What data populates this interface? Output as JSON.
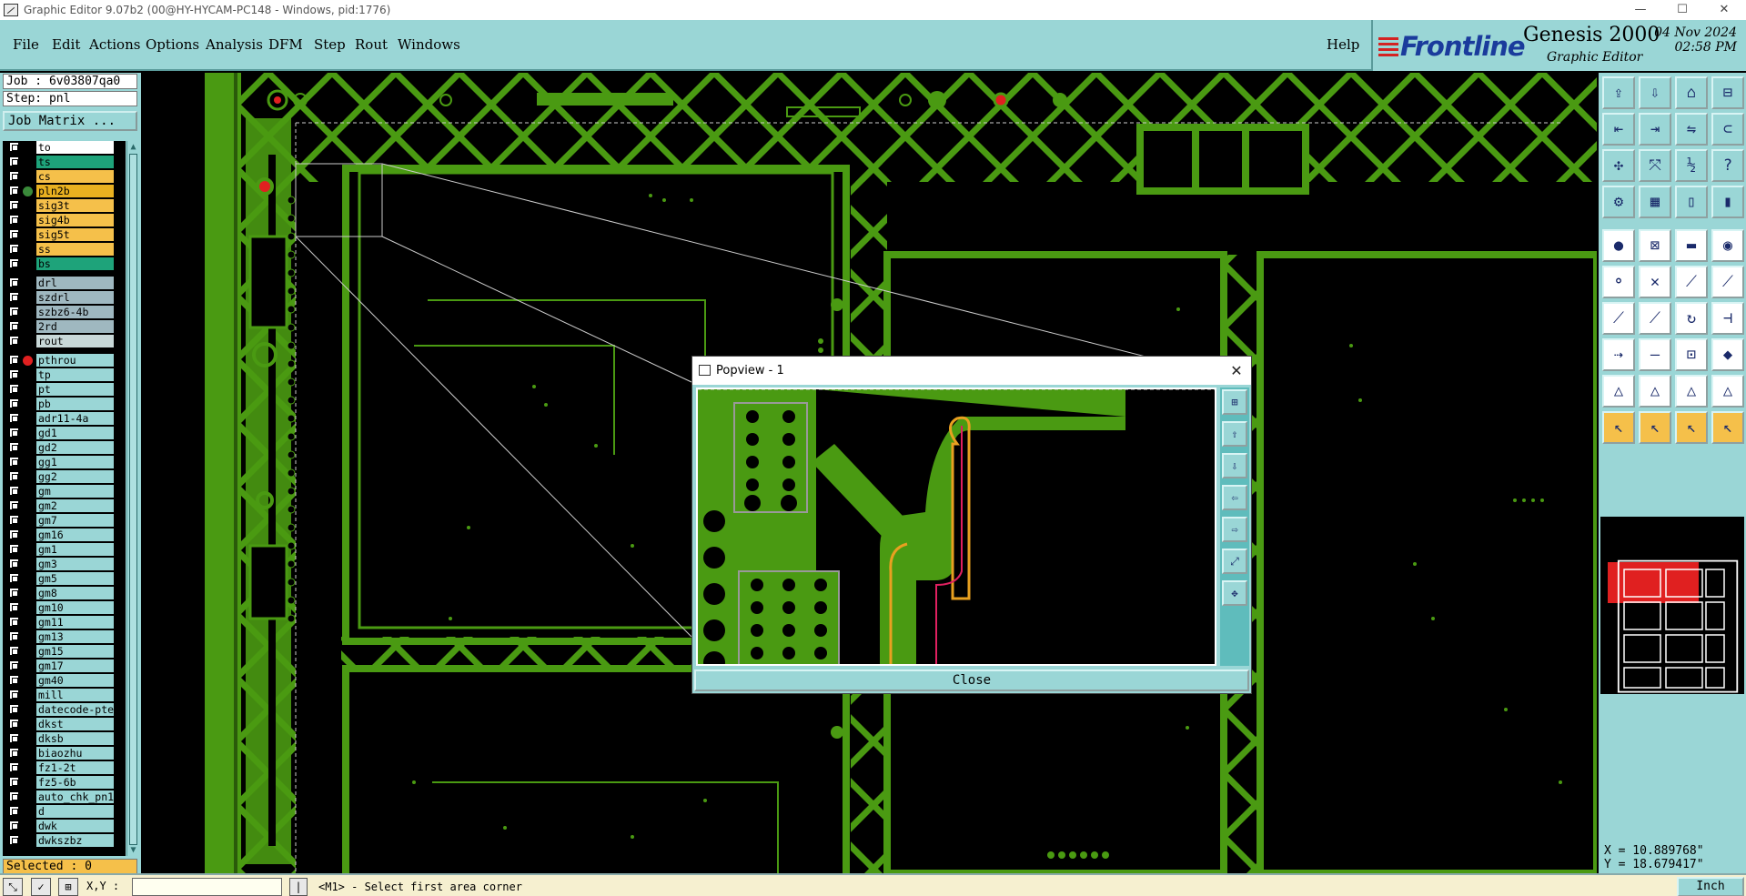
{
  "window": {
    "title": "Graphic Editor 9.07b2 (00@HY-HYCAM-PC148 - Windows, pid:1776)",
    "minimize": "—",
    "maximize": "☐",
    "close": "✕"
  },
  "menu": {
    "items": [
      "File",
      "Edit",
      "Actions",
      "Options",
      "Analysis",
      "DFM",
      "Step",
      "Rout",
      "Windows"
    ],
    "help": "Help"
  },
  "logo": {
    "brand": "Frontline",
    "product": "Genesis 2000",
    "subtitle": "Graphic Editor",
    "date": "04 Nov 2024",
    "time": "02:58 PM"
  },
  "left_panel": {
    "job": "Job : 6v03807qa0",
    "step": "Step: pnl",
    "job_matrix_button": "Job Matrix ...",
    "selected": "Selected : 0"
  },
  "colors": {
    "panel": "#9ad6d6",
    "copper": "#4a9a12",
    "signal_yellow": "#f5c04a",
    "plane_green": "#1ea37a",
    "drill_gray": "#9fb8c0",
    "doc_cyan": "#9ad6d6",
    "active_red": "#e02020"
  },
  "layers": [
    {
      "name": "to",
      "color": "#ffffff",
      "dot": ""
    },
    {
      "name": "ts",
      "color": "#1ea37a",
      "dot": ""
    },
    {
      "name": "cs",
      "color": "#f5c04a",
      "dot": ""
    },
    {
      "name": "pln2b",
      "color": "#e8b020",
      "dot": "#3a8a3a"
    },
    {
      "name": "sig3t",
      "color": "#f5c04a",
      "dot": ""
    },
    {
      "name": "sig4b",
      "color": "#f5c04a",
      "dot": ""
    },
    {
      "name": "sig5t",
      "color": "#f5c04a",
      "dot": ""
    },
    {
      "name": "ss",
      "color": "#f5c04a",
      "dot": ""
    },
    {
      "name": "bs",
      "color": "#1ea37a",
      "dot": ""
    },
    {
      "name": "drl",
      "color": "#9fb8c0",
      "dot": ""
    },
    {
      "name": "szdrl",
      "color": "#9fb8c0",
      "dot": ""
    },
    {
      "name": "szbz6-4b",
      "color": "#9fb8c0",
      "dot": ""
    },
    {
      "name": "2rd",
      "color": "#9fb8c0",
      "dot": ""
    },
    {
      "name": "rout",
      "color": "#c8d8d8",
      "dot": ""
    },
    {
      "name": "pthrou",
      "color": "#9ad6d6",
      "dot": "#e02020"
    },
    {
      "name": "tp",
      "color": "#9ad6d6",
      "dot": ""
    },
    {
      "name": "pt",
      "color": "#9ad6d6",
      "dot": ""
    },
    {
      "name": "pb",
      "color": "#9ad6d6",
      "dot": ""
    },
    {
      "name": "adr11-4a",
      "color": "#9ad6d6",
      "dot": ""
    },
    {
      "name": "gd1",
      "color": "#9ad6d6",
      "dot": ""
    },
    {
      "name": "gd2",
      "color": "#9ad6d6",
      "dot": ""
    },
    {
      "name": "gg1",
      "color": "#9ad6d6",
      "dot": ""
    },
    {
      "name": "gg2",
      "color": "#9ad6d6",
      "dot": ""
    },
    {
      "name": "gm",
      "color": "#9ad6d6",
      "dot": ""
    },
    {
      "name": "gm2",
      "color": "#9ad6d6",
      "dot": ""
    },
    {
      "name": "gm7",
      "color": "#9ad6d6",
      "dot": ""
    },
    {
      "name": "gm16",
      "color": "#9ad6d6",
      "dot": ""
    },
    {
      "name": "gm1",
      "color": "#9ad6d6",
      "dot": ""
    },
    {
      "name": "gm3",
      "color": "#9ad6d6",
      "dot": ""
    },
    {
      "name": "gm5",
      "color": "#9ad6d6",
      "dot": ""
    },
    {
      "name": "gm8",
      "color": "#9ad6d6",
      "dot": ""
    },
    {
      "name": "gm10",
      "color": "#9ad6d6",
      "dot": ""
    },
    {
      "name": "gm11",
      "color": "#9ad6d6",
      "dot": ""
    },
    {
      "name": "gm13",
      "color": "#9ad6d6",
      "dot": ""
    },
    {
      "name": "gm15",
      "color": "#9ad6d6",
      "dot": ""
    },
    {
      "name": "gm17",
      "color": "#9ad6d6",
      "dot": ""
    },
    {
      "name": "gm40",
      "color": "#9ad6d6",
      "dot": ""
    },
    {
      "name": "mill",
      "color": "#9ad6d6",
      "dot": ""
    },
    {
      "name": "datecode-pte",
      "color": "#9ad6d6",
      "dot": ""
    },
    {
      "name": "dkst",
      "color": "#9ad6d6",
      "dot": ""
    },
    {
      "name": "dksb",
      "color": "#9ad6d6",
      "dot": ""
    },
    {
      "name": "biaozhu",
      "color": "#9ad6d6",
      "dot": ""
    },
    {
      "name": "fz1-2t",
      "color": "#9ad6d6",
      "dot": ""
    },
    {
      "name": "fz5-6b",
      "color": "#9ad6d6",
      "dot": ""
    },
    {
      "name": "auto_chk_pn1",
      "color": "#9ad6d6",
      "dot": ""
    },
    {
      "name": "d",
      "color": "#9ad6d6",
      "dot": ""
    },
    {
      "name": "dwk",
      "color": "#9ad6d6",
      "dot": ""
    },
    {
      "name": "dwkszbz",
      "color": "#9ad6d6",
      "dot": ""
    }
  ],
  "popview": {
    "title": "Popview - 1",
    "close_button": "Close",
    "close_icon": "✕"
  },
  "toolbar_icons": [
    "open-icon",
    "save-icon",
    "home-icon",
    "window-split-icon",
    "import-icon",
    "export-icon",
    "mirror-icon",
    "snap-icon",
    "fit-icon",
    "zoom-fit-icon",
    "scale-icon",
    "help-icon",
    "measure-icon",
    "grid-icon",
    "layer-toggle-icon",
    "layer-color-icon",
    "pad-icon",
    "area-select-icon",
    "ruler-icon",
    "circle-icon",
    "connect-icon",
    "cross-icon",
    "node-icon",
    "node-edit-icon",
    "line-icon",
    "line-edit-icon",
    "arc-icon",
    "break-icon",
    "move-icon",
    "distance-icon",
    "copy-icon",
    "shapes-icon",
    "triangle-icon",
    "triangle-a-icon",
    "triangle-b-icon",
    "triangle-c-icon",
    "pointer-icon",
    "pointer-select-icon",
    "pointer-edit-icon",
    "pointer-multi-icon"
  ],
  "coords": {
    "x": "X = 10.889768\"",
    "y": "Y = 18.679417\""
  },
  "status": {
    "xy_label": "X,Y :",
    "prompt": "<M1> - Select first area corner",
    "units": "Inch"
  }
}
